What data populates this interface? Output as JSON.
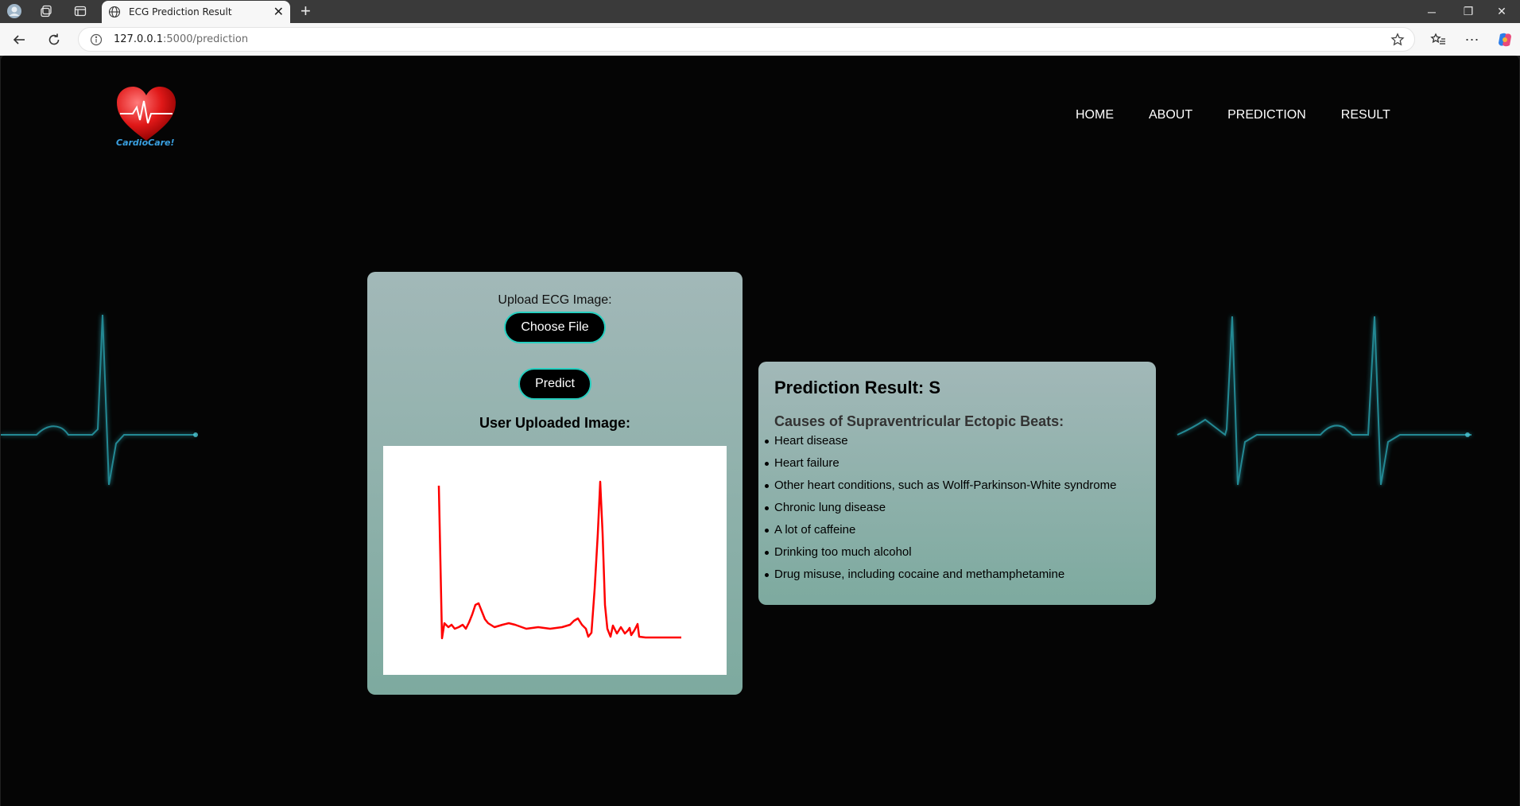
{
  "browser": {
    "tab_title": "ECG Prediction Result",
    "url_host": "127.0.0.1",
    "url_path": ":5000/prediction"
  },
  "site": {
    "logo_text": "CardioCare!",
    "nav": [
      "HOME",
      "ABOUT",
      "PREDICTION",
      "RESULT"
    ]
  },
  "upload": {
    "label": "Upload ECG Image:",
    "choose_label": "Choose File",
    "predict_label": "Predict",
    "uploaded_title": "User Uploaded Image:"
  },
  "result": {
    "title": "Prediction Result: S",
    "causes_title": "Causes of Supraventricular Ectopic Beats:",
    "causes": [
      "Heart disease",
      "Heart failure",
      "Other heart conditions, such as Wolff-Parkinson-White syndrome",
      "Chronic lung disease",
      "A lot of caffeine",
      "Drinking too much alcohol",
      "Drug misuse, including cocaine and methamphetamine"
    ]
  },
  "colors": {
    "card_top": "#a2b8b8",
    "card_bottom": "#7daa9f",
    "button_border": "#27cfc0",
    "ecg_glow": "#2fb6c4",
    "ecg_trace": "#ff0000"
  }
}
